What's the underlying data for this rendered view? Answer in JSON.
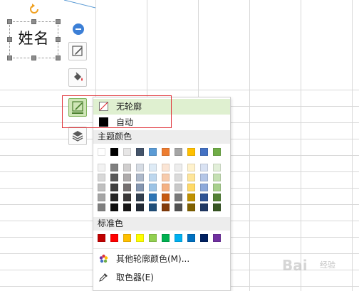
{
  "textbox": {
    "text": "姓名"
  },
  "toolbar": {
    "buttons": [
      "collapse-button",
      "edit-style-button",
      "fill-button",
      "outline-button",
      "layer-button"
    ]
  },
  "menu": {
    "no_outline_label": "无轮廓",
    "auto_label": "自动",
    "theme_colors_label": "主题颜色",
    "standard_colors_label": "标准色",
    "more_colors_label": "其他轮廓颜色(M)...",
    "eyedropper_label": "取色器(E)",
    "theme_colors_top": [
      "#ffffff",
      "#000000",
      "#e7e6e6",
      "#44546a",
      "#5b9bd5",
      "#ed7d31",
      "#a5a5a5",
      "#ffc000",
      "#4472c4",
      "#70ad47"
    ],
    "theme_shades": [
      [
        "#f2f2f2",
        "#7f7f7f",
        "#d0cece",
        "#d6dce4",
        "#deebf6",
        "#fbe5d5",
        "#ededed",
        "#fff2cc",
        "#d9e2f3",
        "#e2efd9"
      ],
      [
        "#d8d8d8",
        "#595959",
        "#aeabab",
        "#adb9ca",
        "#bdd7ee",
        "#f7cbac",
        "#dbdbdb",
        "#fee599",
        "#b4c6e7",
        "#c5e0b3"
      ],
      [
        "#bfbfbf",
        "#3f3f3f",
        "#757070",
        "#8496b0",
        "#9cc3e5",
        "#f4b183",
        "#c9c9c9",
        "#ffd966",
        "#8eaadb",
        "#a8d08d"
      ],
      [
        "#a5a5a5",
        "#262626",
        "#3a3838",
        "#323f4f",
        "#2e75b5",
        "#c55a11",
        "#7b7b7b",
        "#bf9000",
        "#2f5496",
        "#538135"
      ],
      [
        "#7f7f7f",
        "#0c0c0c",
        "#171616",
        "#222a35",
        "#1f4e79",
        "#833c0b",
        "#525252",
        "#7f6000",
        "#1f3864",
        "#375623"
      ]
    ],
    "standard_colors": [
      "#c00000",
      "#ff0000",
      "#ffc000",
      "#ffff00",
      "#92d050",
      "#00b050",
      "#00b0f0",
      "#0070c0",
      "#002060",
      "#7030a0"
    ]
  },
  "watermark": {
    "main": "Bai",
    "sub": "经验"
  },
  "colors": {
    "highlight": "#e0353b",
    "selected_bg": "#dff0d0",
    "accent": "#3c7fd6"
  }
}
